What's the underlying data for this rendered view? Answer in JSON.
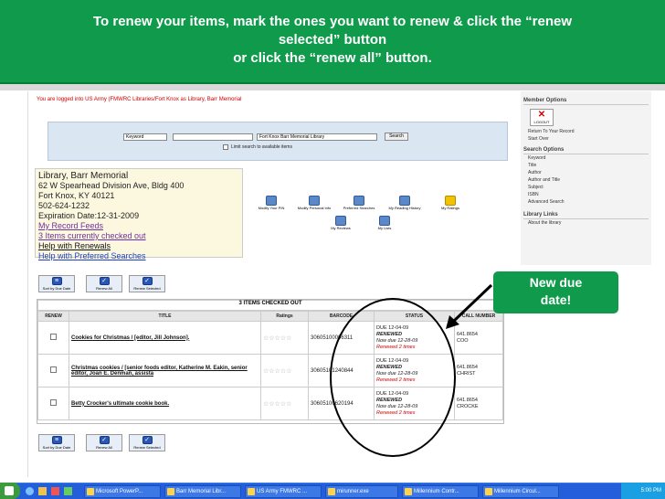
{
  "banner": {
    "line1": "To renew your items, mark the ones you want to renew & click the “renew",
    "line2": "selected” button",
    "line3": "or click the “renew all” button."
  },
  "logged_in": "You are logged into US Army (FMWRC Libraries/Fort Knox as Library, Barr Memorial",
  "search": {
    "type_value": "Keyword",
    "query_value": "",
    "scope_value": "Fort Knox Barr Memorial Library",
    "button": "Search",
    "limit_label": "Limit search to available items"
  },
  "library": {
    "name": "Library, Barr Memorial",
    "address1": "62 W Spearhead Division Ave, Bldg 400",
    "address2": "Fort Knox, KY 40121",
    "phone": "502-624-1232",
    "expiration": "Expiration Date:12-31-2009",
    "links": [
      "My Record Feeds",
      "3 Items currently checked out",
      "Help with Renewals",
      "Help with Preferred Searches"
    ]
  },
  "action_buttons": [
    "Modify Your PIN",
    "Modify Personal Info",
    "Preferred Searches",
    "My Reading History",
    "My Ratings",
    "My Reviews",
    "My Lists"
  ],
  "list_buttons": [
    "Sort by Due Date",
    "Renew All",
    "Renew Selected"
  ],
  "checked_out": {
    "title": "3 ITEMS CHECKED OUT",
    "columns": [
      "RENEW",
      "TITLE",
      "Ratings",
      "BARCODE",
      "STATUS",
      "CALL NUMBER"
    ],
    "rows": [
      {
        "title": "Cookies for Christmas / [editor, Jill Johnson].",
        "barcode": "30605100006311",
        "due": "DUE 12-04-09",
        "renewed": "RENEWED",
        "now_due": "Now due 12-28-09",
        "times": "Renewed 2 times",
        "call": "641.8654",
        "call2": "COO"
      },
      {
        "title": "Christmas cookies / [senior foods editor, Katherine M. Eakin, senior editor, Joan E. Denman, assista",
        "barcode": "30605101240844",
        "due": "DUE 12-04-09",
        "renewed": "RENEWED",
        "now_due": "Now due 12-28-09",
        "times": "Renewed 2 times",
        "call": "641.8654",
        "call2": "CHRIST"
      },
      {
        "title": "Betty Crocker's ultimate cookie book.",
        "barcode": "30605100620194",
        "due": "DUE 12-04-09",
        "renewed": "RENEWED",
        "now_due": "Now due 12-28-09",
        "times": "Renewed 2 times",
        "call": "641.8654",
        "call2": "CROCKE"
      }
    ]
  },
  "right_panel": {
    "member_options_title": "Member Options",
    "logout_label": "LOGOUT",
    "member_items": [
      "Return To Your Record",
      "Start Over"
    ],
    "search_options_title": "Search Options",
    "search_items": [
      "Keyword",
      "Title",
      "Author",
      "Author and Title",
      "Subject",
      "ISBN",
      "Advanced Search"
    ],
    "library_links_title": "Library Links",
    "library_items": [
      "About the library"
    ]
  },
  "callout": {
    "line1": "New due",
    "line2": "date!"
  },
  "taskbar": {
    "items": [
      "Microsoft PowerP...",
      "Barr Memorial Libr...",
      "US Army FMWRC ...",
      "mirunner.exe",
      "Millennium Contr...",
      "Millennium Circul..."
    ],
    "time": "5:00 PM"
  },
  "colors": {
    "banner": "#0f9b4b",
    "taskbar": "#245edb",
    "annotation": "#000000"
  }
}
